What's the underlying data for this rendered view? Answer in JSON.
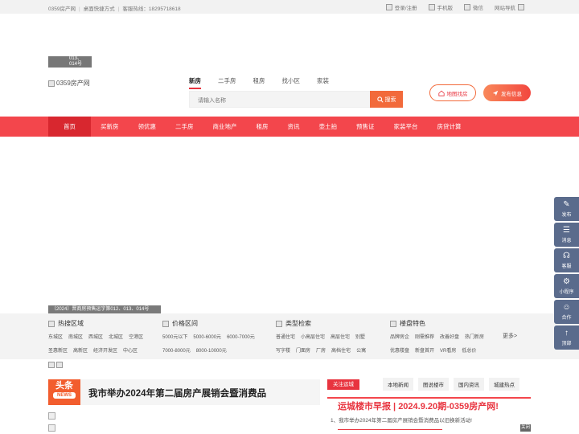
{
  "topbar": {
    "site": "0359房产网",
    "desktop": "桌面快捷方式",
    "hotline": "客服热线：18295718618",
    "login": "登录/注册",
    "mobile": "手机版",
    "wechat": "微信",
    "sitemap": "网站导航"
  },
  "logo": {
    "small_line1": "013、",
    "small_line2": "014号",
    "main_alt": "0359房产网"
  },
  "search": {
    "tabs": [
      "新房",
      "二手房",
      "租房",
      "找小区",
      "家装"
    ],
    "placeholder": "请输入名称",
    "button": "搜索"
  },
  "actions": {
    "map": "地图找房",
    "post": "发布信息"
  },
  "nav": [
    "首页",
    "买新房",
    "领优惠",
    "二手房",
    "商业地产",
    "租房",
    "资讯",
    "壶土拍",
    "预售证",
    "家装平台",
    "房贷计算"
  ],
  "notice": "〔2024〕晋商房预售运字第012、013、014号",
  "filters": {
    "area": {
      "title": "热搜区域",
      "row1": [
        "东城区",
        "南城区",
        "西城区",
        "北城区",
        "空港区"
      ],
      "row2": [
        "圣惠新区",
        "高新区",
        "经济开发区",
        "中心区"
      ]
    },
    "price": {
      "title": "价格区间",
      "row1": [
        "5000元以下",
        "5000-6000元",
        "6000-7000元"
      ],
      "row2": [
        "7000-8000元",
        "8000-10000元"
      ]
    },
    "type": {
      "title": "类型检索",
      "row1": [
        "普通住宅",
        "小高层住宅",
        "高层住宅",
        "别墅"
      ],
      "row2": [
        "写字楼",
        "门面房",
        "厂房",
        "高档住宅",
        "公寓"
      ]
    },
    "feature": {
      "title": "楼盘特色",
      "row1": [
        "品牌房企",
        "刚需推荐",
        "改善好盘",
        "热门新房"
      ],
      "row2": [
        "优惠楼盘",
        "新盘首开",
        "VR看房",
        "低总价"
      ]
    },
    "more": "更多>"
  },
  "headline": {
    "badge_big": "头条",
    "badge_small": "NEWS",
    "text": "我市举办2024年第二届房产展销会暨消费品"
  },
  "right_news": {
    "tag": "关注运城",
    "tabs": [
      "本地新闻",
      "图说楼市",
      "国内资讯",
      "城建热点"
    ],
    "title": "运城楼市早报 | 2024.9.20期-0359房产网!",
    "item": "1、我市举办2024年第二届房产展销会暨消费品以旧换新活动!"
  },
  "sidebar": [
    {
      "icon": "✎",
      "label": "发布"
    },
    {
      "icon": "☰",
      "label": "消息"
    },
    {
      "icon": "☊",
      "label": "客服"
    },
    {
      "icon": "⚙",
      "label": "小程序"
    },
    {
      "icon": "☺",
      "label": "合作"
    },
    {
      "icon": "↑",
      "label": "顶部"
    }
  ],
  "close": "关闭",
  "colors": {
    "primary": "#f3464c",
    "accent": "#f26a3b",
    "sidebar": "#5a6b8c"
  }
}
